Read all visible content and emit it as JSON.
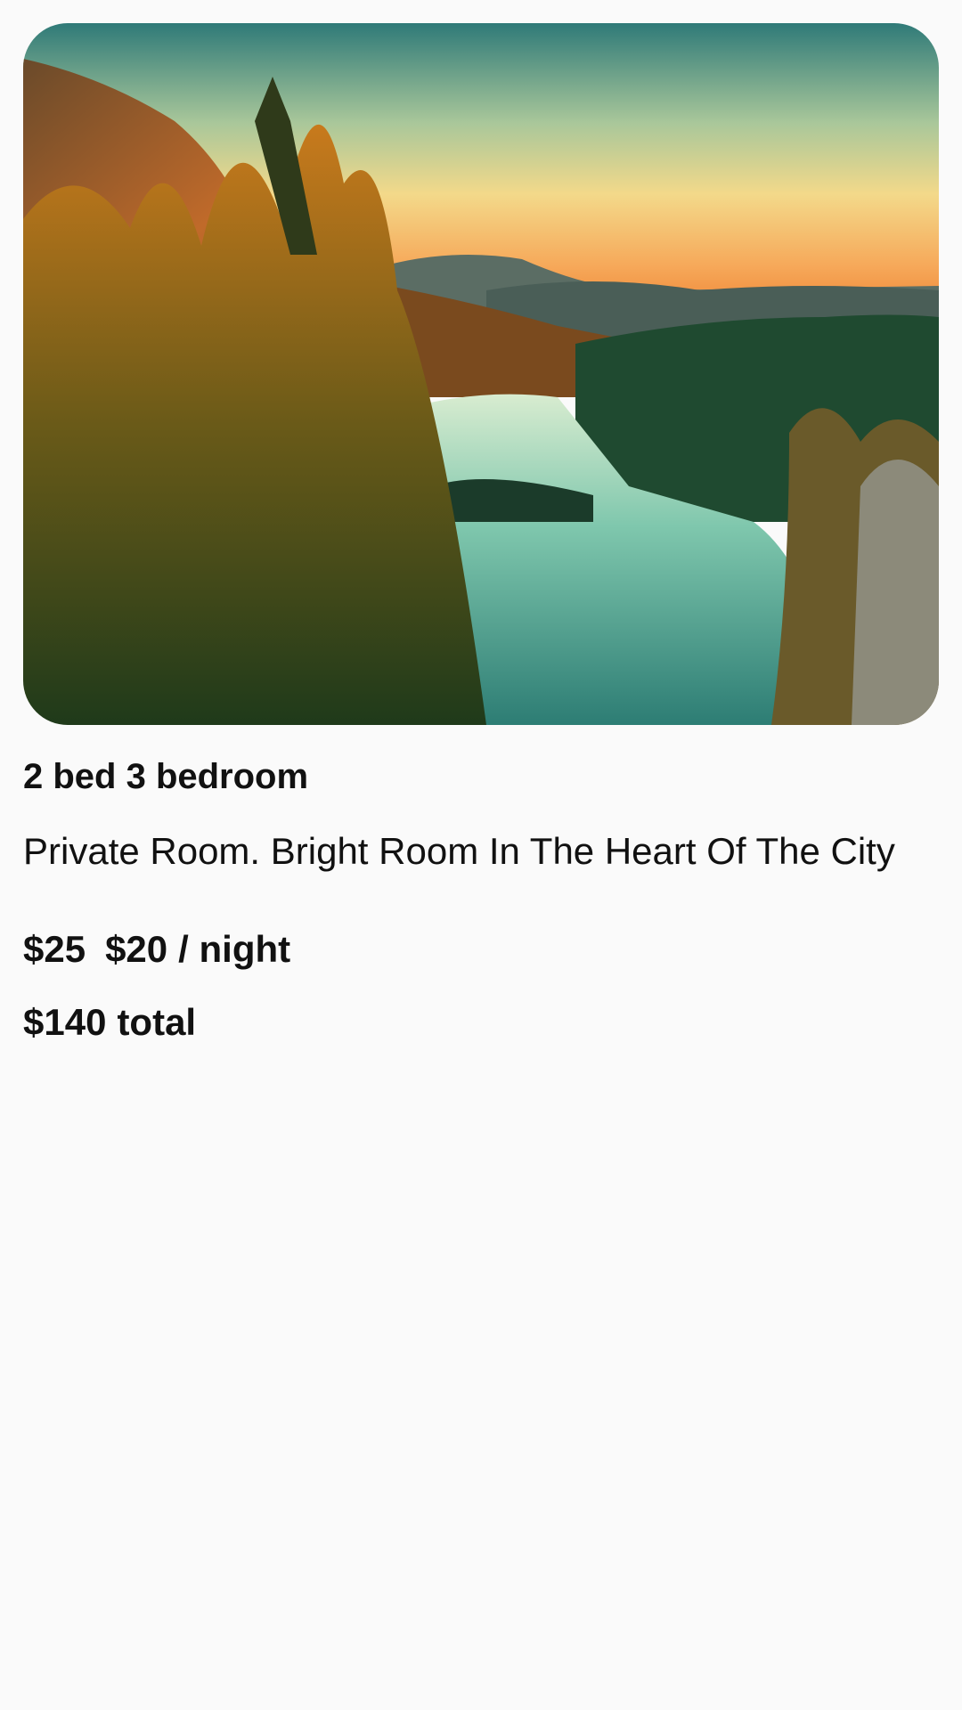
{
  "listing": {
    "image_alt": "Mountain lake at sunset with pine forest",
    "title": "2 bed 3 bedroom",
    "description": "Private Room. Bright Room In The Heart Of The City",
    "original_price": "$25",
    "price": "$20",
    "price_unit": "/ night",
    "total_price": "$140",
    "total_label": "total"
  },
  "colors": {
    "background": "#fafafa",
    "text": "#111111"
  }
}
